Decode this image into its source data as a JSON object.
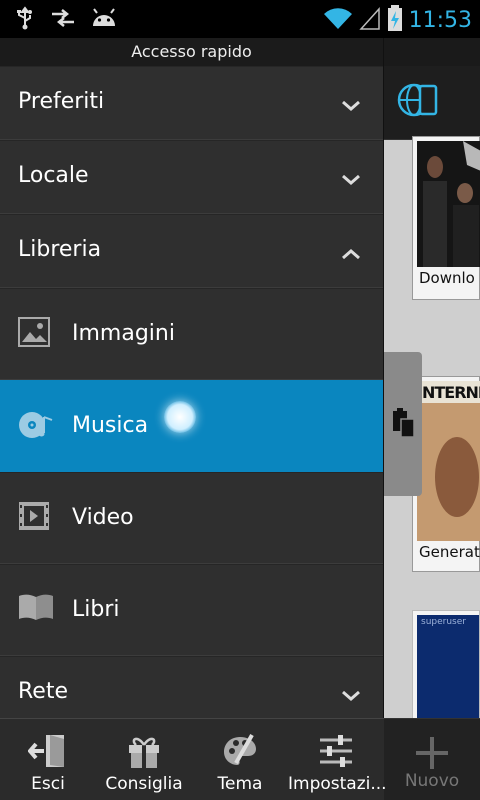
{
  "status_bar": {
    "time": "11:53"
  },
  "drawer": {
    "header": "Accesso rapido",
    "sections_top": [
      {
        "label": "Preferiti",
        "state": "collapsed"
      },
      {
        "label": "Locale",
        "state": "collapsed"
      },
      {
        "label": "Libreria",
        "state": "expanded"
      }
    ],
    "library_items": [
      {
        "label": "Immagini",
        "icon": "image-icon"
      },
      {
        "label": "Musica",
        "icon": "music-disc-icon",
        "selected": true
      },
      {
        "label": "Video",
        "icon": "film-icon"
      },
      {
        "label": "Libri",
        "icon": "book-icon"
      }
    ],
    "section_bottom": {
      "label": "Rete",
      "state": "collapsed"
    }
  },
  "toolbar": {
    "exit_label": "Esci",
    "recommend_label": "Consiglia",
    "theme_label": "Tema",
    "settings_label": "Impostazi..."
  },
  "background_app": {
    "thumb_captions": [
      "Downlo",
      "Generat"
    ],
    "thumb_banner": "INTERNE",
    "thumb_small_text": "superuser",
    "new_label": "Nuovo"
  },
  "colors": {
    "accent": "#33b5e5",
    "selected": "#0a86bf",
    "drawer_bg": "#2f2f2f"
  }
}
